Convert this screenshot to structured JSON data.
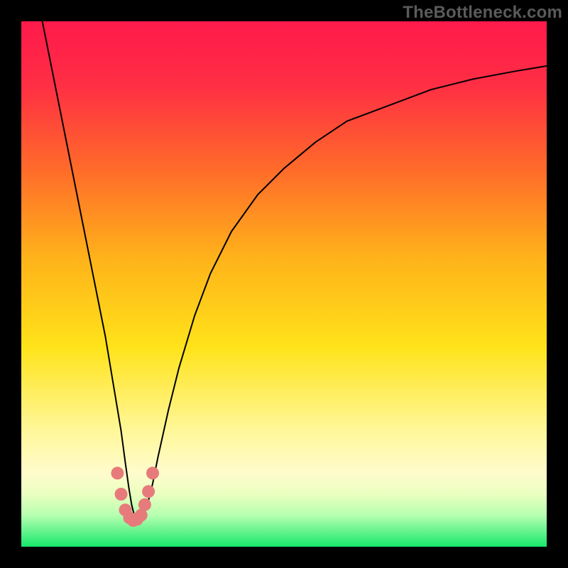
{
  "watermark": "TheBottleneck.com",
  "chart_data": {
    "type": "line",
    "title": "",
    "xlabel": "",
    "ylabel": "",
    "xlim": [
      0,
      100
    ],
    "ylim": [
      0,
      100
    ],
    "grid": false,
    "background_gradient": {
      "stops": [
        {
          "pct": 0,
          "color": "#ff1a4b"
        },
        {
          "pct": 12,
          "color": "#ff2e44"
        },
        {
          "pct": 28,
          "color": "#ff6a2a"
        },
        {
          "pct": 45,
          "color": "#ffb21a"
        },
        {
          "pct": 62,
          "color": "#ffe31a"
        },
        {
          "pct": 78,
          "color": "#fff79a"
        },
        {
          "pct": 86,
          "color": "#fffccc"
        },
        {
          "pct": 90,
          "color": "#eaffc0"
        },
        {
          "pct": 94,
          "color": "#b6ffb0"
        },
        {
          "pct": 100,
          "color": "#17e86b"
        }
      ]
    },
    "series": [
      {
        "name": "bottleneck-curve",
        "color": "#000000",
        "width": 2,
        "x": [
          4,
          6,
          8,
          10,
          12,
          14,
          16,
          17,
          18,
          19,
          19.8,
          20.5,
          21,
          21.5,
          22,
          22.6,
          23.2,
          24,
          25,
          26,
          28,
          30,
          33,
          36,
          40,
          45,
          50,
          56,
          62,
          70,
          78,
          86,
          94,
          100
        ],
        "y": [
          100,
          90,
          80,
          70,
          60,
          50,
          40,
          34,
          28,
          22,
          16,
          11,
          8,
          6,
          5,
          5,
          6,
          8,
          12,
          17,
          26,
          34,
          44,
          52,
          60,
          67,
          72,
          77,
          81,
          84,
          87,
          89,
          90.5,
          91.5
        ]
      },
      {
        "name": "valley-highlight",
        "color": "#e77b7b",
        "type": "scatter",
        "marker_radius": 9,
        "x": [
          18.3,
          19.0,
          19.8,
          20.6,
          21.3,
          22.0,
          22.8,
          23.5,
          24.2,
          25.0
        ],
        "y": [
          14,
          10,
          7,
          5.5,
          5,
          5.2,
          6,
          8,
          10.5,
          14
        ]
      }
    ],
    "annotations": []
  }
}
